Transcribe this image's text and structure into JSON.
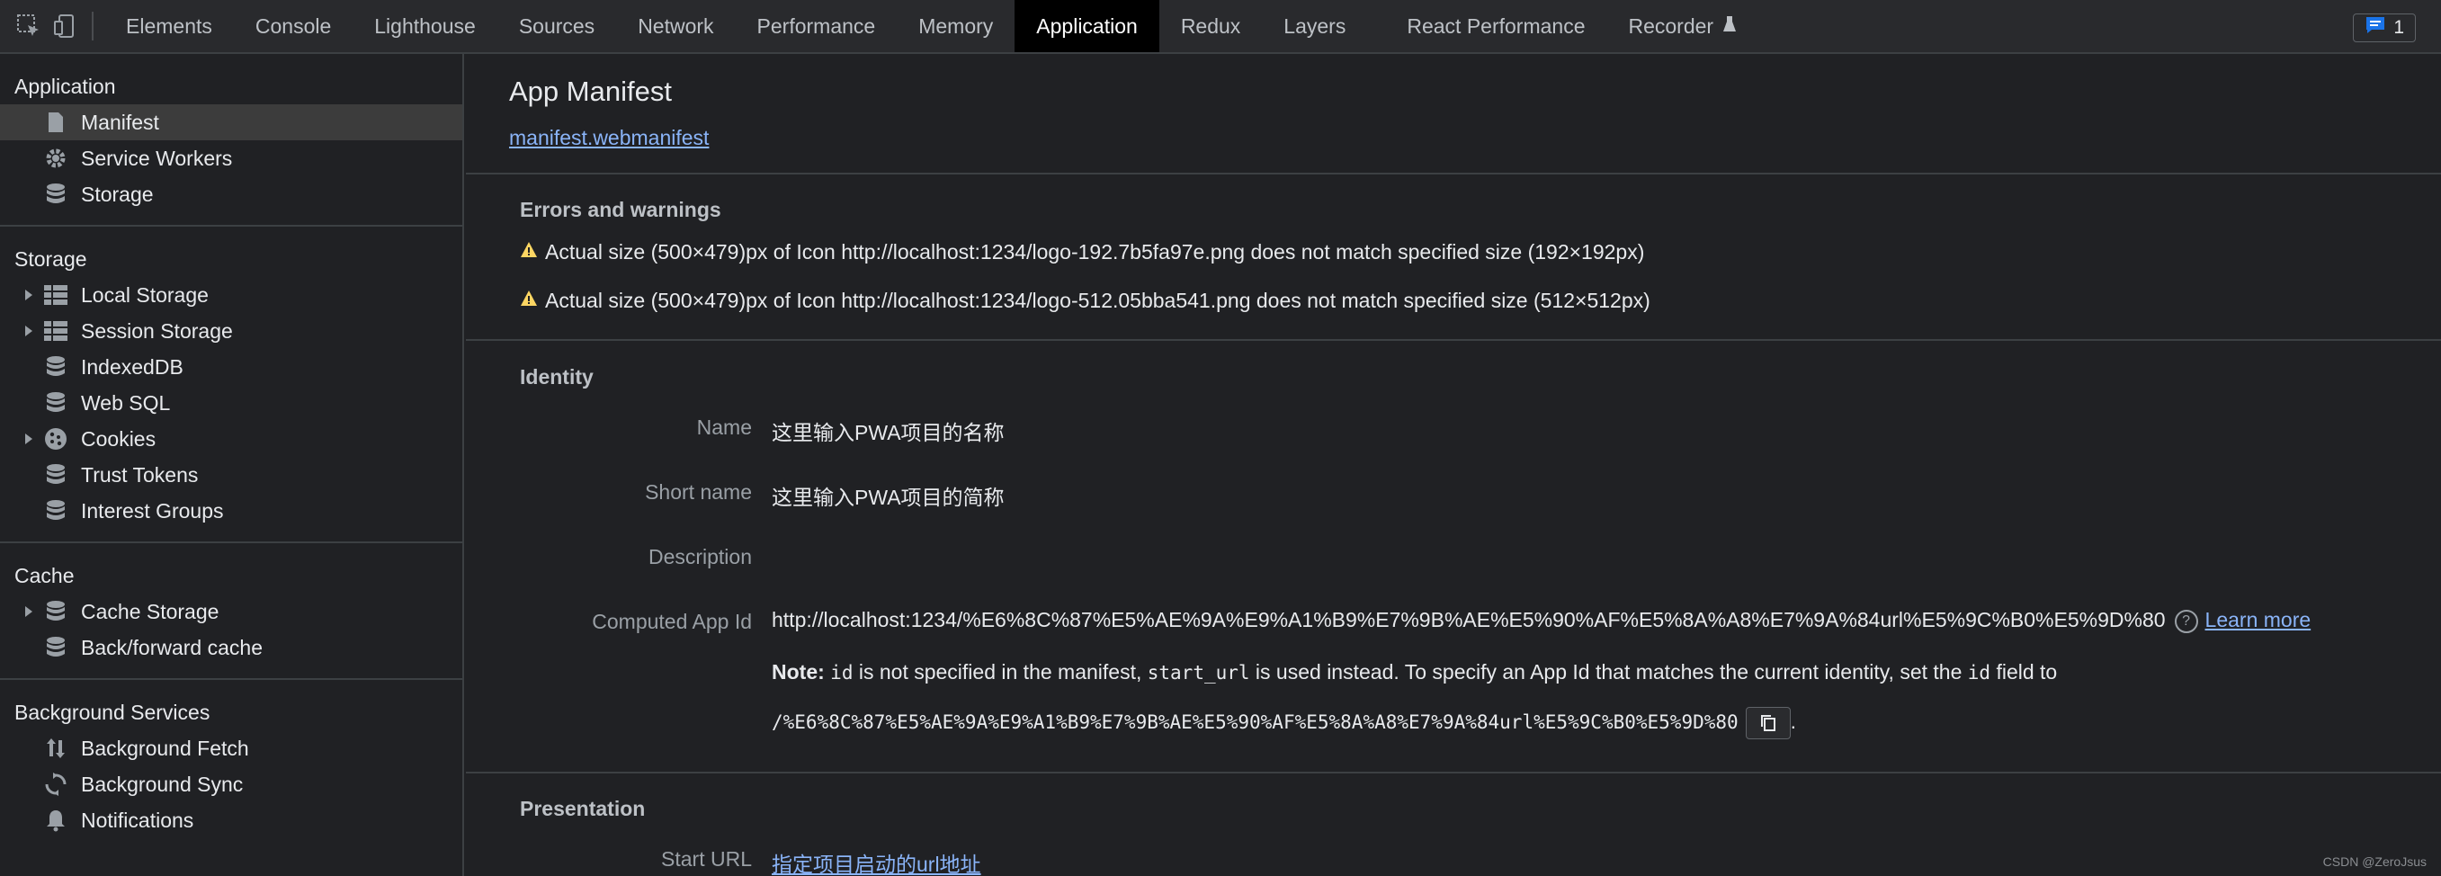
{
  "toolbar": {
    "tabs": [
      "Elements",
      "Console",
      "Lighthouse",
      "Sources",
      "Network",
      "Performance",
      "Memory",
      "Application",
      "Redux",
      "Layers",
      "React Performance",
      "Recorder"
    ],
    "active_tab": "Application",
    "issues_count": "1"
  },
  "sidebar": {
    "application": {
      "title": "Application",
      "items": [
        "Manifest",
        "Service Workers",
        "Storage"
      ]
    },
    "storage": {
      "title": "Storage",
      "items": [
        "Local Storage",
        "Session Storage",
        "IndexedDB",
        "Web SQL",
        "Cookies",
        "Trust Tokens",
        "Interest Groups"
      ]
    },
    "cache": {
      "title": "Cache",
      "items": [
        "Cache Storage",
        "Back/forward cache"
      ]
    },
    "background": {
      "title": "Background Services",
      "items": [
        "Background Fetch",
        "Background Sync",
        "Notifications"
      ]
    }
  },
  "main": {
    "title": "App Manifest",
    "manifest_link": "manifest.webmanifest",
    "errors_title": "Errors and warnings",
    "warnings": [
      "Actual size (500×479)px of Icon http://localhost:1234/logo-192.7b5fa97e.png does not match specified size (192×192px)",
      "Actual size (500×479)px of Icon http://localhost:1234/logo-512.05bba541.png does not match specified size (512×512px)"
    ],
    "identity_title": "Identity",
    "identity": {
      "name_label": "Name",
      "name_value": "这里输入PWA项目的名称",
      "short_label": "Short name",
      "short_value": "这里输入PWA项目的简称",
      "desc_label": "Description",
      "desc_value": "",
      "appid_label": "Computed App Id",
      "appid_value": "http://localhost:1234/%E6%8C%87%E5%AE%9A%E9%A1%B9%E7%9B%AE%E5%90%AF%E5%8A%A8%E7%9A%84url%E5%9C%B0%E5%9D%80",
      "learn_more": "Learn more",
      "note_bold": "Note:",
      "note_code1": "id",
      "note_text1": " is not specified in the manifest, ",
      "note_code2": "start_url",
      "note_text2": " is used instead. To specify an App Id that matches the current identity, set the ",
      "note_code3": "id",
      "note_text3": " field to",
      "suggested_id": "/%E6%8C%87%E5%AE%9A%E9%A1%B9%E7%9B%AE%E5%90%AF%E5%8A%A8%E7%9A%84url%E5%9C%B0%E5%9D%80",
      "suggested_tail": "."
    },
    "presentation_title": "Presentation",
    "presentation": {
      "start_url_label": "Start URL",
      "start_url_value": "指定项目启动的url地址"
    }
  },
  "watermark": "CSDN @ZeroJsus"
}
